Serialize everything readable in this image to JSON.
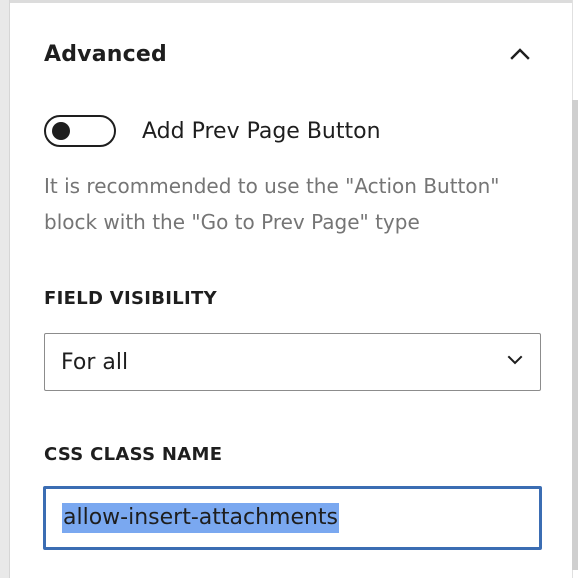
{
  "panel": {
    "title": "Advanced",
    "collapse_icon": "chevron-up-icon"
  },
  "toggle": {
    "label": "Add Prev Page Button",
    "checked": false
  },
  "help_text": "It is recommended to use the \"Action Button\" block with the \"Go to Prev Page\" type",
  "field_visibility": {
    "label": "FIELD VISIBILITY",
    "selected": "For all",
    "dropdown_icon": "chevron-down-icon"
  },
  "css_class": {
    "label": "CSS CLASS NAME",
    "value": "allow-insert-attachments",
    "text_selected": true
  },
  "colors": {
    "focus_border": "#3b6db3",
    "selection": "#7aa8f0",
    "help_text": "#757575"
  }
}
